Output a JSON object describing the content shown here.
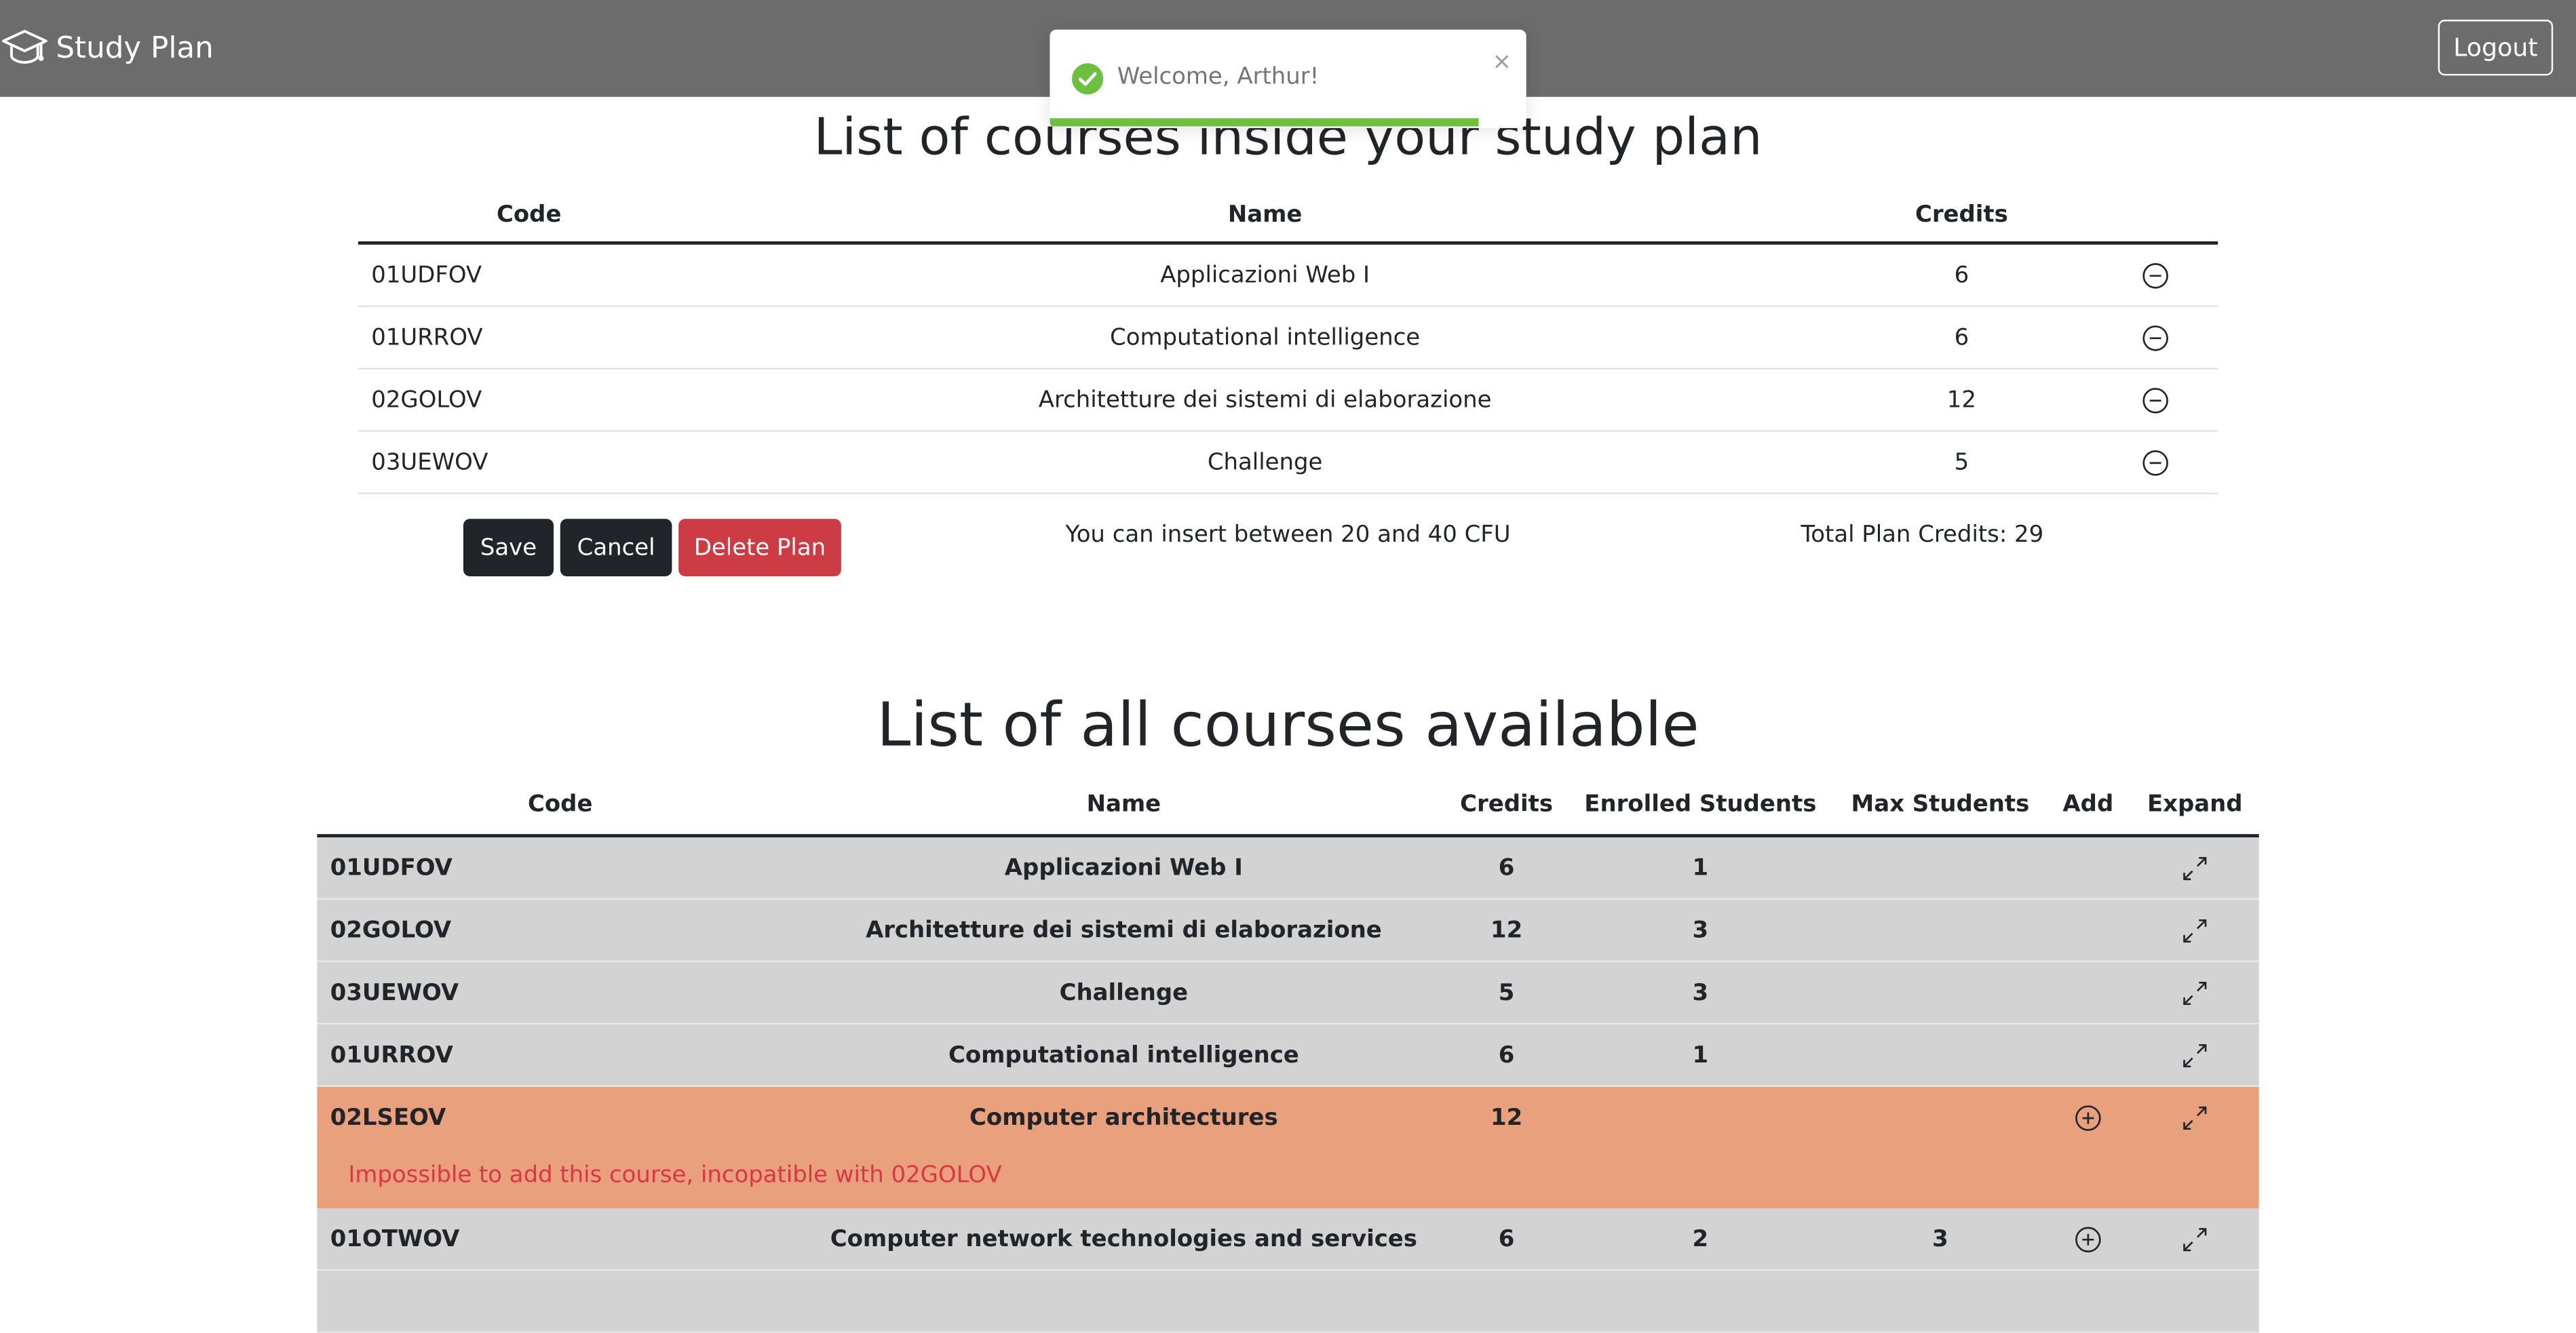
{
  "navbar": {
    "brand": "Study Plan",
    "logout_label": "Logout"
  },
  "toast": {
    "message": "Welcome, Arthur!",
    "close_symbol": "×",
    "progress": 0.9
  },
  "plan": {
    "title": "List of courses inside your study plan",
    "columns": {
      "code": "Code",
      "name": "Name",
      "credits": "Credits"
    },
    "rows": [
      {
        "code": "01UDFOV",
        "name": "Applicazioni Web I",
        "credits": "6"
      },
      {
        "code": "01URROV",
        "name": "Computational intelligence",
        "credits": "6"
      },
      {
        "code": "02GOLOV",
        "name": "Architetture dei sistemi di elaborazione",
        "credits": "12"
      },
      {
        "code": "03UEWOV",
        "name": "Challenge",
        "credits": "5"
      }
    ],
    "save_label": "Save",
    "cancel_label": "Cancel",
    "delete_label": "Delete Plan",
    "cfu_info": "You can insert between 20 and 40 CFU",
    "total_credits": "Total Plan Credits: 29"
  },
  "courses": {
    "title": "List of all courses available",
    "columns": {
      "code": "Code",
      "name": "Name",
      "credits": "Credits",
      "enrolled": "Enrolled Students",
      "max": "Max Students",
      "add": "Add",
      "expand": "Expand"
    },
    "rows": [
      {
        "code": "01UDFOV",
        "name": "Applicazioni Web I",
        "credits": "6",
        "enrolled": "1",
        "max": ""
      },
      {
        "code": "02GOLOV",
        "name": "Architetture dei sistemi di elaborazione",
        "credits": "12",
        "enrolled": "3",
        "max": ""
      },
      {
        "code": "03UEWOV",
        "name": "Challenge",
        "credits": "5",
        "enrolled": "3",
        "max": ""
      },
      {
        "code": "01URROV",
        "name": "Computational intelligence",
        "credits": "6",
        "enrolled": "1",
        "max": ""
      },
      {
        "code": "02LSEOV",
        "name": "Computer architectures",
        "credits": "12",
        "enrolled": "",
        "max": "",
        "message": "Impossible to add this course, incopatible with 02GOLOV"
      },
      {
        "code": "01OTWOV",
        "name": "Computer network technologies and services",
        "credits": "6",
        "enrolled": "2",
        "max": "3"
      }
    ]
  },
  "colors": {
    "navbar": "#6c6c6c",
    "row_default": "#d3d3d3",
    "row_incompatible": "#e9a07c",
    "danger": "#dc3545",
    "delete_button": "#cd3c45",
    "success": "#6cbf3f"
  },
  "icons": {
    "brand": "graduation-cap-icon",
    "remove": "dash-circle-icon",
    "add": "plus-circle-icon",
    "expand": "arrows-angle-expand-icon",
    "toast": "check-circle-icon"
  }
}
